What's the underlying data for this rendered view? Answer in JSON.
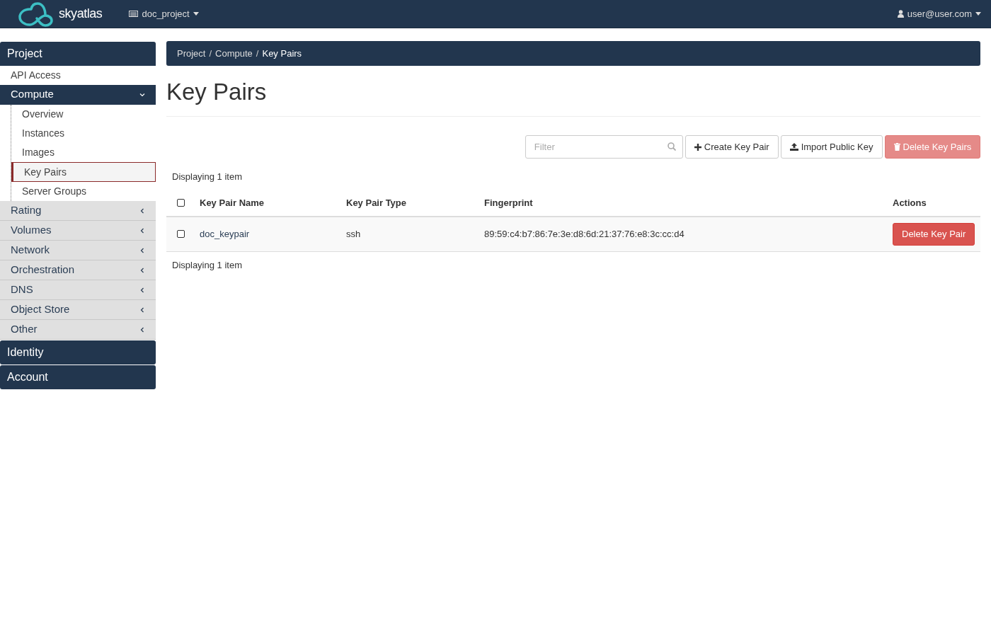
{
  "topbar": {
    "brand": "skyatlas",
    "project": "doc_project",
    "user": "user@user.com"
  },
  "sidebar": [
    {
      "label": "Project",
      "expanded": true,
      "items": [
        {
          "kind": "link",
          "label": "API Access"
        },
        {
          "kind": "group",
          "label": "Compute",
          "expanded": true,
          "children": [
            {
              "label": "Overview",
              "selected": false
            },
            {
              "label": "Instances",
              "selected": false
            },
            {
              "label": "Images",
              "selected": false
            },
            {
              "label": "Key Pairs",
              "selected": true
            },
            {
              "label": "Server Groups",
              "selected": false
            }
          ]
        },
        {
          "kind": "group",
          "label": "Rating",
          "expanded": false
        },
        {
          "kind": "group",
          "label": "Volumes",
          "expanded": false
        },
        {
          "kind": "group",
          "label": "Network",
          "expanded": false
        },
        {
          "kind": "group",
          "label": "Orchestration",
          "expanded": false
        },
        {
          "kind": "group",
          "label": "DNS",
          "expanded": false
        },
        {
          "kind": "group",
          "label": "Object Store",
          "expanded": false
        },
        {
          "kind": "group",
          "label": "Other",
          "expanded": false
        }
      ]
    },
    {
      "label": "Identity",
      "expanded": false
    },
    {
      "label": "Account",
      "expanded": false
    }
  ],
  "breadcrumb": [
    "Project",
    "Compute",
    "Key Pairs"
  ],
  "breadcrumb_separator": "/",
  "title": "Key Pairs",
  "toolbar": {
    "filter_placeholder": "Filter",
    "buttons": [
      {
        "kind": "create",
        "label": "Create Key Pair",
        "disabled": false
      },
      {
        "kind": "import",
        "label": "Import Public Key",
        "disabled": false
      },
      {
        "kind": "delete",
        "label": "Delete Key Pairs",
        "disabled": true
      }
    ]
  },
  "table": {
    "count_top": "Displaying 1 item",
    "columns": [
      "Key Pair Name",
      "Key Pair Type",
      "Fingerprint",
      "Actions"
    ],
    "all_checked": false,
    "rows": [
      {
        "checked": false,
        "name": "doc_keypair",
        "type": "ssh",
        "fingerprint": "89:59:c4:b7:86:7e:3e:d8:6d:21:37:76:e8:3c:cc:d4",
        "action": "Delete Key Pair"
      }
    ],
    "count_bottom": "Displaying 1 item"
  }
}
